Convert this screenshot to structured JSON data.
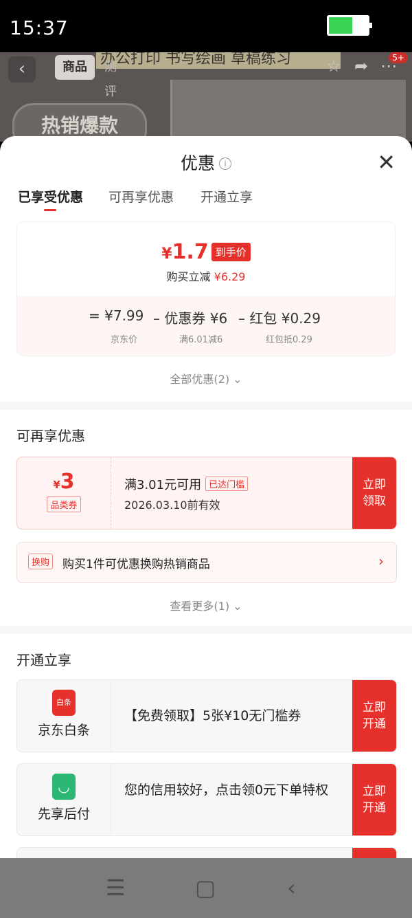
{
  "status_bar": {
    "time": "15:37"
  },
  "background_page": {
    "tabs": [
      "商品",
      "测评"
    ],
    "banner_text": "办公打印 书写绘画 草稿练习",
    "hot_label": "热销爆款",
    "cart_badge": "5+"
  },
  "sheet": {
    "title": "优惠",
    "info_icon_char": "i",
    "close_char": "✕",
    "tabs": [
      {
        "label": "已享受优惠"
      },
      {
        "label": "可再享优惠"
      },
      {
        "label": "开通立享"
      }
    ],
    "price": {
      "yen": "¥",
      "amount": "1.7",
      "tag": "到手价",
      "sub_prefix": "购买立减 ",
      "sub_value": "¥6.29",
      "breakdown": [
        {
          "text": "= ¥7.99",
          "label": "京东价"
        },
        {
          "text": "– 优惠券 ¥6",
          "label": "满6.01减6"
        },
        {
          "text": "– 红包 ¥0.29",
          "label": "红包抵0.29"
        }
      ],
      "all_link": "全部优惠(2)"
    },
    "section_more": {
      "title": "可再享优惠",
      "coupon": {
        "yen": "¥",
        "amount": "3",
        "type": "品类券",
        "condition": "满3.01元可用",
        "badge": "已达门槛",
        "expiry": "2026.03.10前有效",
        "action": "立即\n领取"
      },
      "swap": {
        "tag": "换购",
        "text": "购买1件可优惠换购热销商品",
        "chevron": "›"
      },
      "more_link": "查看更多(1)"
    },
    "section_open": {
      "title": "开通立享",
      "cards": [
        {
          "name": "京东白条",
          "icon_text": "白条",
          "desc": "【免费领取】5张¥10无门槛券",
          "action": "立即\n开通"
        },
        {
          "name": "先享后付",
          "icon_text": "◡",
          "desc": "您的信用较好，点击领0元下单特权",
          "action": "立即\n开通"
        }
      ]
    }
  },
  "nav_bar": {
    "menu": "☰",
    "home": "▢",
    "back": "‹"
  },
  "colors": {
    "accent": "#e5302b",
    "green": "#39d353"
  }
}
